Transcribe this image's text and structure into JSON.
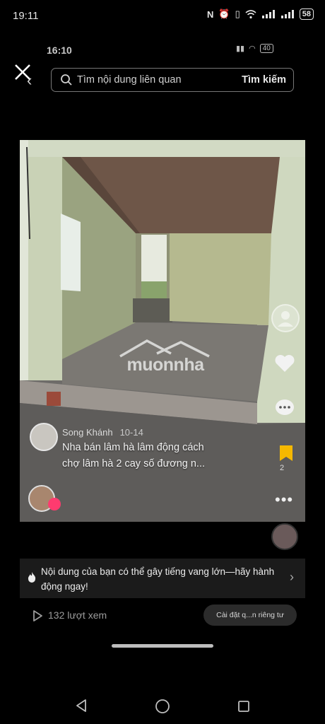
{
  "status_bar": {
    "time": "19:11",
    "battery": "58"
  },
  "inner_status": {
    "time": "16:10",
    "battery": "40"
  },
  "search": {
    "placeholder": "Tìm nội dung liên quan",
    "button_label": "Tìm kiếm"
  },
  "watermark": "muonnha",
  "caption": {
    "username": "Song Khánh",
    "date": "10-14",
    "line1": "Nha bán lâm hà lâm động cách",
    "line2": "chợ lâm hà 2 cay số đương n..."
  },
  "actions": {
    "bookmark_count": "2"
  },
  "notice": {
    "text": "Nội dung của bạn có thể gây tiếng vang lớn—hãy hành động ngay!"
  },
  "views": {
    "text": "132 lượt xem"
  },
  "privacy_button": "Cài đặt q...n riêng tư",
  "colors": {
    "background": "#000000",
    "bookmark": "#f5b800",
    "badge": "#ff3b6f"
  }
}
